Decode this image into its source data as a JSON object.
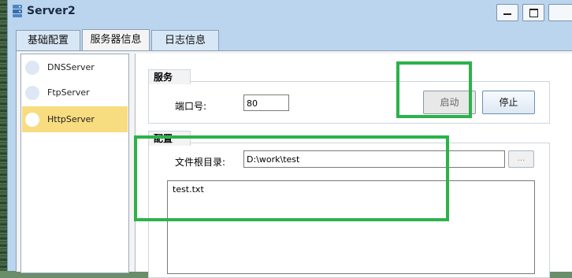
{
  "window": {
    "title": "Server2"
  },
  "tabs": [
    {
      "label": "基础配置"
    },
    {
      "label": "服务器信息"
    },
    {
      "label": "日志信息"
    }
  ],
  "sidebar": {
    "items": [
      {
        "label": "DNSServer",
        "active": false
      },
      {
        "label": "FtpServer",
        "active": false
      },
      {
        "label": "HttpServer",
        "active": true
      }
    ]
  },
  "service": {
    "group_title": "服务",
    "port_label": "端口号:",
    "port_value": "80",
    "start_label": "启动",
    "stop_label": "停止"
  },
  "config": {
    "group_title": "配置",
    "root_label": "文件根目录:",
    "root_value": "D:\\work\\test",
    "browse_label": "...",
    "files": [
      "test.txt"
    ]
  },
  "colors": {
    "highlight": "#2cb24a",
    "active_item": "#f8dc80",
    "window_bg": "#bcd5ee"
  }
}
